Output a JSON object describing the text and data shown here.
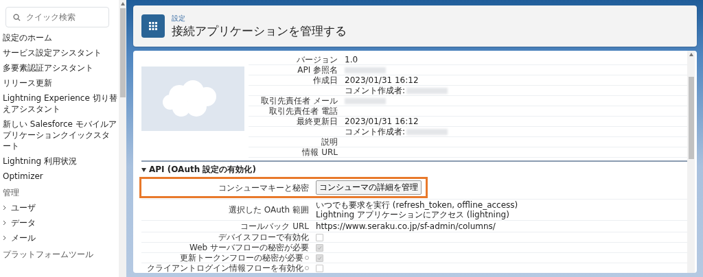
{
  "sidebar": {
    "search": {
      "placeholder": "クイック検索"
    },
    "items": [
      {
        "label": "設定のホーム",
        "kind": "link"
      },
      {
        "label": "サービス設定アシスタント",
        "kind": "link"
      },
      {
        "label": "多要素認証アシスタント",
        "kind": "link"
      },
      {
        "label": "リリース更新",
        "kind": "link"
      },
      {
        "label": "Lightning Experience 切り替えアシスタント",
        "kind": "link"
      },
      {
        "label": "新しい Salesforce モバイルアプリケーションクイックスタート",
        "kind": "link"
      },
      {
        "label": "Lightning 利用状況",
        "kind": "link"
      },
      {
        "label": "Optimizer",
        "kind": "link"
      },
      {
        "label": "管理",
        "kind": "heading"
      },
      {
        "label": "ユーザ",
        "kind": "group",
        "expanded": false
      },
      {
        "label": "データ",
        "kind": "group",
        "expanded": false
      },
      {
        "label": "メール",
        "kind": "group",
        "expanded": false
      },
      {
        "label": "プラットフォームツール",
        "kind": "heading"
      }
    ]
  },
  "header": {
    "breadcrumb": "設定",
    "title": "接続アプリケーションを管理する"
  },
  "detail": {
    "rows": [
      {
        "label": "バージョン",
        "value": "1.0",
        "redacted": false
      },
      {
        "label": "API 参照名",
        "redacted": true
      },
      {
        "label": "作成日",
        "value": "2023/01/31 16:12",
        "redacted": false
      },
      {
        "value": "コメント作成者:",
        "redacted": true
      },
      {
        "label": "取引先責任者 メール",
        "redacted": true
      },
      {
        "label": "取引先責任者 電話",
        "redacted": false
      },
      {
        "label": "最終更新日",
        "value": "2023/01/31 16:12",
        "redacted": false
      },
      {
        "value": "コメント作成者:",
        "redacted": true
      },
      {
        "label": "説明",
        "redacted": false
      },
      {
        "label": "情報 URL",
        "redacted": false
      }
    ]
  },
  "api": {
    "title": "API (OAuth 設定の有効化)",
    "expanded": true,
    "rows": [
      {
        "kind": "button",
        "label": "コンシューマキーと秘密",
        "button": "コンシューマの詳細を管理",
        "highlighted": true
      },
      {
        "kind": "text",
        "label": "選択した OAuth 範囲",
        "lines": [
          "いつでも要求を実行 (refresh_token, offline_access)",
          "Lightning アプリケーションにアクセス (lightning)"
        ]
      },
      {
        "kind": "text",
        "label": "コールバック URL",
        "lines": [
          "https://www.seraku.co.jp/sf-admin/columns/"
        ]
      },
      {
        "kind": "checkbox",
        "label": "デバイスフローで有効化",
        "checked": false,
        "info": false
      },
      {
        "kind": "checkbox",
        "label": "Web サーバフローの秘密が必要",
        "checked": true,
        "info": false
      },
      {
        "kind": "checkbox",
        "label": "更新トークンフローの秘密が必要",
        "checked": true,
        "info": true
      },
      {
        "kind": "checkbox",
        "label": "クライアントログイン情報フローを有効化",
        "checked": false,
        "info": true
      }
    ]
  }
}
